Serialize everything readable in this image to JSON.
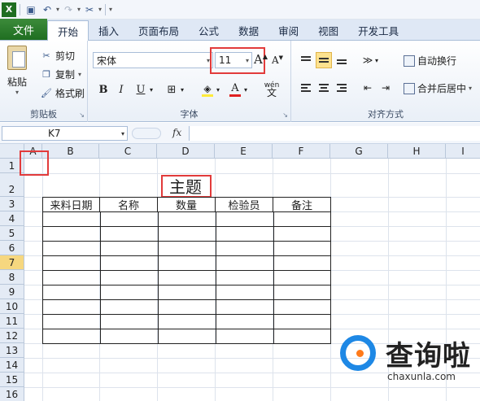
{
  "qat": {
    "icons": [
      "excel-icon",
      "save-icon",
      "undo-icon",
      "redo-icon",
      "customize-icon"
    ]
  },
  "tabs": [
    {
      "label": "文件"
    },
    {
      "label": "开始"
    },
    {
      "label": "插入"
    },
    {
      "label": "页面布局"
    },
    {
      "label": "公式"
    },
    {
      "label": "数据"
    },
    {
      "label": "审阅"
    },
    {
      "label": "视图"
    },
    {
      "label": "开发工具"
    }
  ],
  "ribbon": {
    "clipboard": {
      "paste_label": "粘贴",
      "cut_label": "剪切",
      "copy_label": "复制",
      "format_painter_label": "格式刷",
      "group_label": "剪贴板"
    },
    "font": {
      "font_name": "宋体",
      "font_size": "11",
      "grow_label": "A",
      "shrink_label": "A",
      "bold": "B",
      "italic": "I",
      "underline": "U",
      "wen_label": "wén",
      "group_label": "字体"
    },
    "alignment": {
      "wrap_text_label": "自动换行",
      "merge_center_label": "合并后居中",
      "group_label": "对齐方式"
    }
  },
  "formula_bar": {
    "name_box": "K7",
    "fx_label": "fx",
    "formula": ""
  },
  "sheet": {
    "columns": [
      "A",
      "B",
      "C",
      "D",
      "E",
      "F",
      "G",
      "H",
      "I"
    ],
    "rows": [
      "1",
      "2",
      "3",
      "4",
      "5",
      "6",
      "7",
      "8",
      "9",
      "10",
      "11",
      "12",
      "13",
      "14",
      "15",
      "16"
    ],
    "selected_row": "7",
    "title": "主题",
    "headers": [
      "来料日期",
      "名称",
      "数量",
      "检验员",
      "备注"
    ]
  },
  "watermark": {
    "cn": "查询啦",
    "en": "chaxunla.com"
  }
}
